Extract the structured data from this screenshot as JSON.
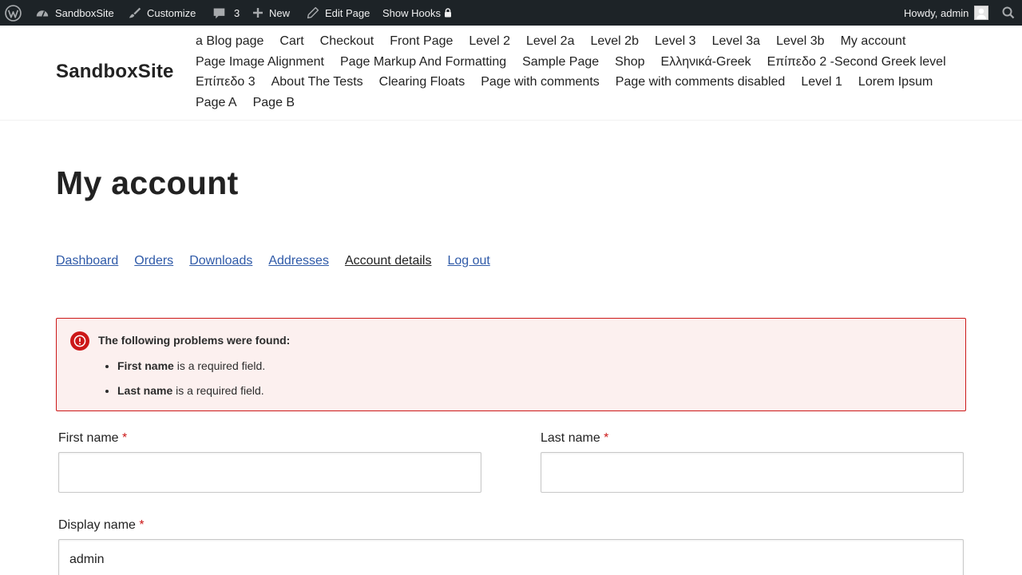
{
  "admin_bar": {
    "wp_logo_icon": "wordpress-icon",
    "site_name": "SandboxSite",
    "customize": "Customize",
    "comments_count": "3",
    "new_label": "New",
    "edit_page": "Edit Page",
    "show_hooks": "Show Hooks",
    "howdy": "Howdy, admin"
  },
  "header": {
    "site_title": "SandboxSite",
    "nav": [
      "a Blog page",
      "Cart",
      "Checkout",
      "Front Page",
      "Level 2",
      "Level 2a",
      "Level 2b",
      "Level 3",
      "Level 3a",
      "Level 3b",
      "My account",
      "Page Image Alignment",
      "Page Markup And Formatting",
      "Sample Page",
      "Shop",
      "Ελληνικά-Greek",
      "Επίπεδο 2 -Second Greek level",
      "Επίπεδο 3",
      "About The Tests",
      "Clearing Floats",
      "Page with comments",
      "Page with comments disabled",
      "Level 1",
      "Lorem Ipsum",
      "Page A",
      "Page B"
    ]
  },
  "main": {
    "title": "My account",
    "account_nav": [
      {
        "label": "Dashboard",
        "active": false
      },
      {
        "label": "Orders",
        "active": false
      },
      {
        "label": "Downloads",
        "active": false
      },
      {
        "label": "Addresses",
        "active": false
      },
      {
        "label": "Account details",
        "active": true
      },
      {
        "label": "Log out",
        "active": false
      }
    ]
  },
  "notice": {
    "title": "The following problems were found:",
    "errors": [
      {
        "field": "First name",
        "message": " is a required field."
      },
      {
        "field": "Last name",
        "message": " is a required field."
      }
    ]
  },
  "form": {
    "first_name_label": "First name",
    "last_name_label": "Last name",
    "display_name_label": "Display name",
    "required_mark": "*",
    "first_name_value": "",
    "last_name_value": "",
    "display_name_value": "admin"
  },
  "colors": {
    "admin_bar_bg": "#1d2327",
    "link": "#2f5aa8",
    "error": "#cc1818",
    "notice_bg": "#fcf0ef"
  }
}
